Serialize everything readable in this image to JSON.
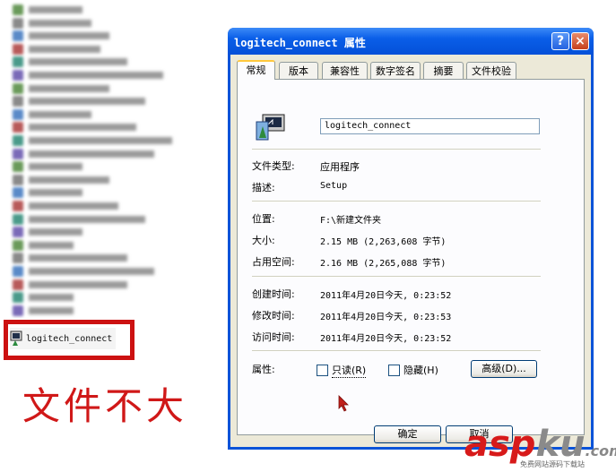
{
  "left": {
    "highlighted_file": "logitech_connect",
    "caption": "文件不大"
  },
  "dialog": {
    "title": "logitech_connect 属性",
    "help_glyph": "?",
    "close_glyph": "×",
    "tabs": [
      "常规",
      "版本",
      "兼容性",
      "数字签名",
      "摘要",
      "文件校验"
    ],
    "active_tab": "常规",
    "name_value": "logitech_connect",
    "rows": [
      {
        "label": "文件类型:",
        "value": "应用程序"
      },
      {
        "label": "描述:",
        "value": "Setup"
      },
      {
        "label": "位置:",
        "value": "F:\\新建文件夹"
      },
      {
        "label": "大小:",
        "value": "2.15 MB (2,263,608 字节)"
      },
      {
        "label": "占用空间:",
        "value": "2.16 MB (2,265,088 字节)"
      },
      {
        "label": "创建时间:",
        "value": "2011年4月20日今天, 0:23:52"
      },
      {
        "label": "修改时间:",
        "value": "2011年4月20日今天, 0:23:53"
      },
      {
        "label": "访问时间:",
        "value": "2011年4月20日今天, 0:23:52"
      }
    ],
    "attributes_label": "属性:",
    "readonly_label": "只读(R)",
    "hidden_label": "隐藏(H)",
    "advanced_button": "高级(D)...",
    "ok_button": "确定",
    "cancel_button": "取消",
    "readonly_checked": false,
    "hidden_checked": false
  },
  "watermark": {
    "main_red": "asp",
    "main_gray": "ku",
    "suffix": ".com",
    "sub": "免费网站源码下载站"
  },
  "colors": {
    "title_blue": "#0a53d8",
    "highlight_red": "#cc1111",
    "dialog_face": "#ece9d8"
  }
}
